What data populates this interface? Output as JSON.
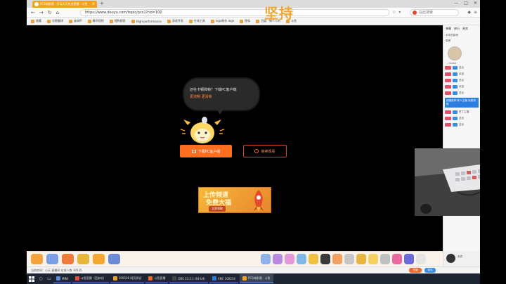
{
  "overlay": {
    "watermark": "坚持"
  },
  "browser": {
    "tab_title": "PCS神剧通 · 好玩天天有虎直播 - 斗鱼",
    "new_tab": "+",
    "url": "https://www.douyu.com/topic/pcs1?rid=100",
    "search_placeholder": "在此搜索",
    "window_controls": [
      "—",
      "□",
      "✕"
    ],
    "nav": [
      "←",
      "→",
      "↻",
      "⌂"
    ],
    "bookmarks": [
      "收藏",
      "谷歌翻译",
      "查询IP",
      "腾讯视频",
      "搜狗搜索",
      "High-performance",
      "游戏开发",
      "在线工具",
      "logo制作 logo",
      "图标",
      "百度 · 每个人的",
      "斗鱼"
    ]
  },
  "player": {
    "bubble_line1": "还在卡顿掉帧？下载PC客户端",
    "bubble_line2": "更流畅 更清晰",
    "client_button": "下载PC客户端",
    "fast_button": "继续观看",
    "banner_line1": "上传频道",
    "banner_line2": "免费大福",
    "banner_cta": "立即领取"
  },
  "sidebar": {
    "tabs": [
      "弹幕",
      "排行",
      "贵宾"
    ],
    "subtitle": "本场贡献榜",
    "rank_label": "周榜",
    "fan_name": "j shake",
    "notice": "超管推荐 新人主播 免费领取",
    "chat_names": [
      "送出",
      "欢迎",
      "送出",
      "欢迎",
      "送出",
      "赞了主播",
      "送出",
      "送出"
    ]
  },
  "status": {
    "text": "当前房间：小天 直播间 在线人数 30535",
    "btn1": "充值",
    "btn2": "背包"
  },
  "giftbar": {
    "side_text": "贵宾"
  },
  "taskbar": {
    "apps": [
      {
        "label": "MINI",
        "color": "#5a8fd8"
      },
      {
        "label": "斗鱼直播（西安站）",
        "color": "#e84c3d"
      },
      {
        "label": "100536 网页测试",
        "color": "#f0a020"
      },
      {
        "label": "斗鱼直播",
        "color": "#e86a20"
      },
      {
        "label": "OBS 23.2.1 (64-bit)",
        "color": "#444"
      },
      {
        "label": "XNC 100234",
        "color": "#2a7de0"
      },
      {
        "label": "PCS神剧通 · 斗鱼",
        "color": "#f4a21a"
      }
    ]
  }
}
